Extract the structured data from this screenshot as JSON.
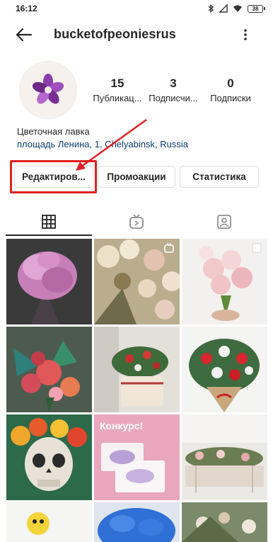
{
  "status_bar": {
    "time": "16:12",
    "battery": "38"
  },
  "header": {
    "username": "bucketofpeoniesrus",
    "back_icon": "back-arrow-icon",
    "menu_icon": "more-vertical-icon"
  },
  "profile": {
    "avatar_icon": "flower-logo-icon",
    "stats": [
      {
        "value": "15",
        "label": "Публикац..."
      },
      {
        "value": "3",
        "label": "Подписчи..."
      },
      {
        "value": "0",
        "label": "Подписки"
      }
    ],
    "category": "Цветочная лавка",
    "address": "площадь Ленина, 1, Chelyabinsk, Russia"
  },
  "buttons": {
    "edit": "Редактиров...",
    "promotions": "Промоакции",
    "statistics": "Статистика"
  },
  "tabs": [
    {
      "icon": "grid-icon",
      "selected": true
    },
    {
      "icon": "igtv-icon",
      "selected": false
    },
    {
      "icon": "tagged-icon",
      "selected": false
    }
  ],
  "posts": [
    {
      "overlay_text": ""
    },
    {
      "overlay_text": "",
      "badge": "igtv-icon"
    },
    {
      "overlay_text": "",
      "badge": "multiple-photos-icon"
    },
    {
      "overlay_text": ""
    },
    {
      "overlay_text": ""
    },
    {
      "overlay_text": ""
    },
    {
      "overlay_text": ""
    },
    {
      "overlay_text": "Конкурс!"
    },
    {
      "overlay_text": ""
    },
    {
      "overlay_text": ""
    },
    {
      "overlay_text": ""
    },
    {
      "overlay_text": ""
    }
  ],
  "colors": {
    "highlight": "#e02020",
    "address_link": "#0b3d6e",
    "avatar_flower": "#8b3fa8"
  }
}
